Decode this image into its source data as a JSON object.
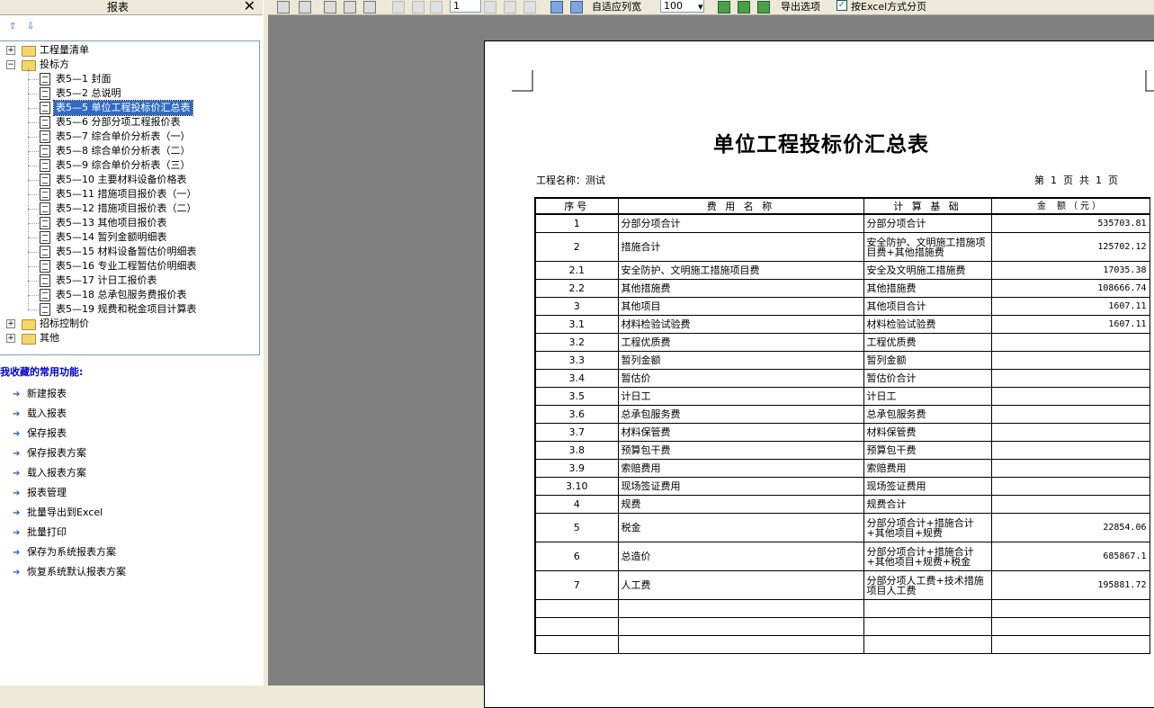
{
  "panel": {
    "title": "报表",
    "close": "✕"
  },
  "tree": [
    {
      "label": "工程量清单",
      "level": 0,
      "expanded": false
    },
    {
      "label": "投标方",
      "level": 0,
      "expanded": true
    },
    {
      "label": "表5—1 封面",
      "level": 1
    },
    {
      "label": "表5—2 总说明",
      "level": 1
    },
    {
      "label": "表5—5 单位工程投标价汇总表",
      "level": 1,
      "selected": true
    },
    {
      "label": "表5—6 分部分项工程报价表",
      "level": 1
    },
    {
      "label": "表5—7 综合单价分析表（一）",
      "level": 1
    },
    {
      "label": "表5—8 综合单价分析表（二）",
      "level": 1
    },
    {
      "label": "表5—9 综合单价分析表（三）",
      "level": 1
    },
    {
      "label": "表5—10 主要材料设备价格表",
      "level": 1
    },
    {
      "label": "表5—11 措施项目报价表（一）",
      "level": 1
    },
    {
      "label": "表5—12 措施项目报价表（二）",
      "level": 1
    },
    {
      "label": "表5—13 其他项目报价表",
      "level": 1
    },
    {
      "label": "表5—14 暂列金额明细表",
      "level": 1
    },
    {
      "label": "表5—15 材料设备暂估价明细表",
      "level": 1
    },
    {
      "label": "表5—16 专业工程暂估价明细表",
      "level": 1
    },
    {
      "label": "表5—17 计日工报价表",
      "level": 1
    },
    {
      "label": "表5—18 总承包服务费报价表",
      "level": 1
    },
    {
      "label": "表5—19 规费和税金项目计算表",
      "level": 1
    },
    {
      "label": "招标控制价",
      "level": 0,
      "expanded": false
    },
    {
      "label": "其他",
      "level": 0,
      "expanded": false
    }
  ],
  "favorites": {
    "title": "我收藏的常用功能:",
    "items": [
      "新建报表",
      "载入报表",
      "保存报表",
      "保存报表方案",
      "载入报表方案",
      "报表管理",
      "批量导出到Excel",
      "批量打印",
      "保存为系统报表方案",
      "恢复系统默认报表方案"
    ]
  },
  "toolbar": {
    "page_value": "1",
    "fit_label": "自适应列宽",
    "zoom_value": "100",
    "export_options": "导出选项",
    "excel_paging_label": "按Excel方式分页",
    "excel_paging_checked": true
  },
  "report": {
    "title": "单位工程投标价汇总表",
    "project_label": "工程名称：测试",
    "page_info": "第  1  页  共  1  页",
    "headers": [
      "序号",
      "费 用 名 称",
      "计 算 基 础",
      "金 额（元）"
    ],
    "rows": [
      [
        "1",
        "分部分项合计",
        "分部分项合计",
        "535703.81"
      ],
      [
        "2",
        "措施合计",
        "安全防护、文明施工措施项目费+其他措施费",
        "125702.12"
      ],
      [
        "2.1",
        "安全防护、文明施工措施项目费",
        "安全及文明施工措施费",
        "17035.38"
      ],
      [
        "2.2",
        "其他措施费",
        "其他措施费",
        "108666.74"
      ],
      [
        "3",
        "其他项目",
        "其他项目合计",
        "1607.11"
      ],
      [
        "3.1",
        "材料检验试验费",
        "材料检验试验费",
        "1607.11"
      ],
      [
        "3.2",
        "工程优质费",
        "工程优质费",
        ""
      ],
      [
        "3.3",
        "暂列金额",
        "暂列金额",
        ""
      ],
      [
        "3.4",
        "暂估价",
        "暂估价合计",
        ""
      ],
      [
        "3.5",
        "计日工",
        "计日工",
        ""
      ],
      [
        "3.6",
        "总承包服务费",
        "总承包服务费",
        ""
      ],
      [
        "3.7",
        "材料保管费",
        "材料保管费",
        ""
      ],
      [
        "3.8",
        "预算包干费",
        "预算包干费",
        ""
      ],
      [
        "3.9",
        "索赔费用",
        "索赔费用",
        ""
      ],
      [
        "3.10",
        "现场签证费用",
        "现场签证费用",
        ""
      ],
      [
        "4",
        "规费",
        "规费合计",
        ""
      ],
      [
        "5",
        "税金",
        "分部分项合计+措施合计+其他项目+规费",
        "22854.06"
      ],
      [
        "6",
        "总造价",
        "分部分项合计+措施合计+其他项目+规费+税金",
        "685867.1"
      ],
      [
        "7",
        "人工费",
        "分部分项人工费+技术措施项目人工费",
        "195881.72"
      ],
      [
        "",
        "",
        "",
        ""
      ],
      [
        "",
        "",
        "",
        ""
      ],
      [
        "",
        "",
        "",
        ""
      ]
    ]
  }
}
